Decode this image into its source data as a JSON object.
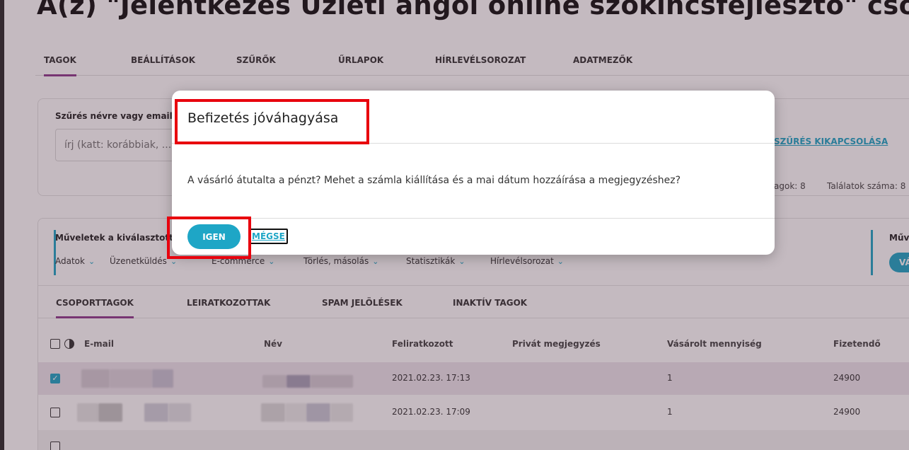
{
  "page": {
    "title": "A(z) \"Jelentkezés Üzleti angol online szókincsfejlesztő\" csoport",
    "tabs": [
      "TAGOK",
      "BEÁLLÍTÁSOK",
      "SZŰRŐK",
      "ŰRLAPOK",
      "HÍRLEVÉLSOROZAT",
      "ADATMEZŐK"
    ]
  },
  "filter": {
    "label": "Szűrés névre vagy email",
    "placeholder": "írj (katt: korábbiak, ...",
    "disable_link": "SZŰRÉS KIKAPCSOLÁSA",
    "stat_members": "agok: 8",
    "stat_results": "Találatok száma: 8"
  },
  "operations": {
    "title": "Műveletek a kiválasztott",
    "menu": [
      "Adatok",
      "Üzenetküldés",
      "E-commerce",
      "Törlés, másolás",
      "Statisztikák",
      "Hírlevélsorozat"
    ],
    "right_label": "Műv",
    "right_button": "VÁ"
  },
  "member_tabs": [
    "CSOPORTTAGOK",
    "LEIRATKOZOTTAK",
    "SPAM JELÖLÉSEK",
    "INAKTÍV TAGOK"
  ],
  "table": {
    "columns": [
      "E-mail",
      "Név",
      "Feliratkozott",
      "Privát megjegyzés",
      "Vásárolt mennyiség",
      "Fizetendő"
    ],
    "rows": [
      {
        "subscribed": "2021.02.23. 17:13",
        "note": "",
        "quantity": "1",
        "due": "24900",
        "checked": true
      },
      {
        "subscribed": "2021.02.23. 17:09",
        "note": "",
        "quantity": "1",
        "due": "24900",
        "checked": false
      }
    ]
  },
  "modal": {
    "title": "Befizetés jóváhagyása",
    "body": "A vásárló átutalta a pénzt? Mehet a számla kiállítása és a mai dátum hozzáírása a megjegyzéshez?",
    "confirm": "IGEN",
    "cancel": "MÉGSE"
  },
  "colors": {
    "accent": "#1ea6c6",
    "active_tab": "#8e3b8c",
    "highlight": "#e8000d"
  }
}
